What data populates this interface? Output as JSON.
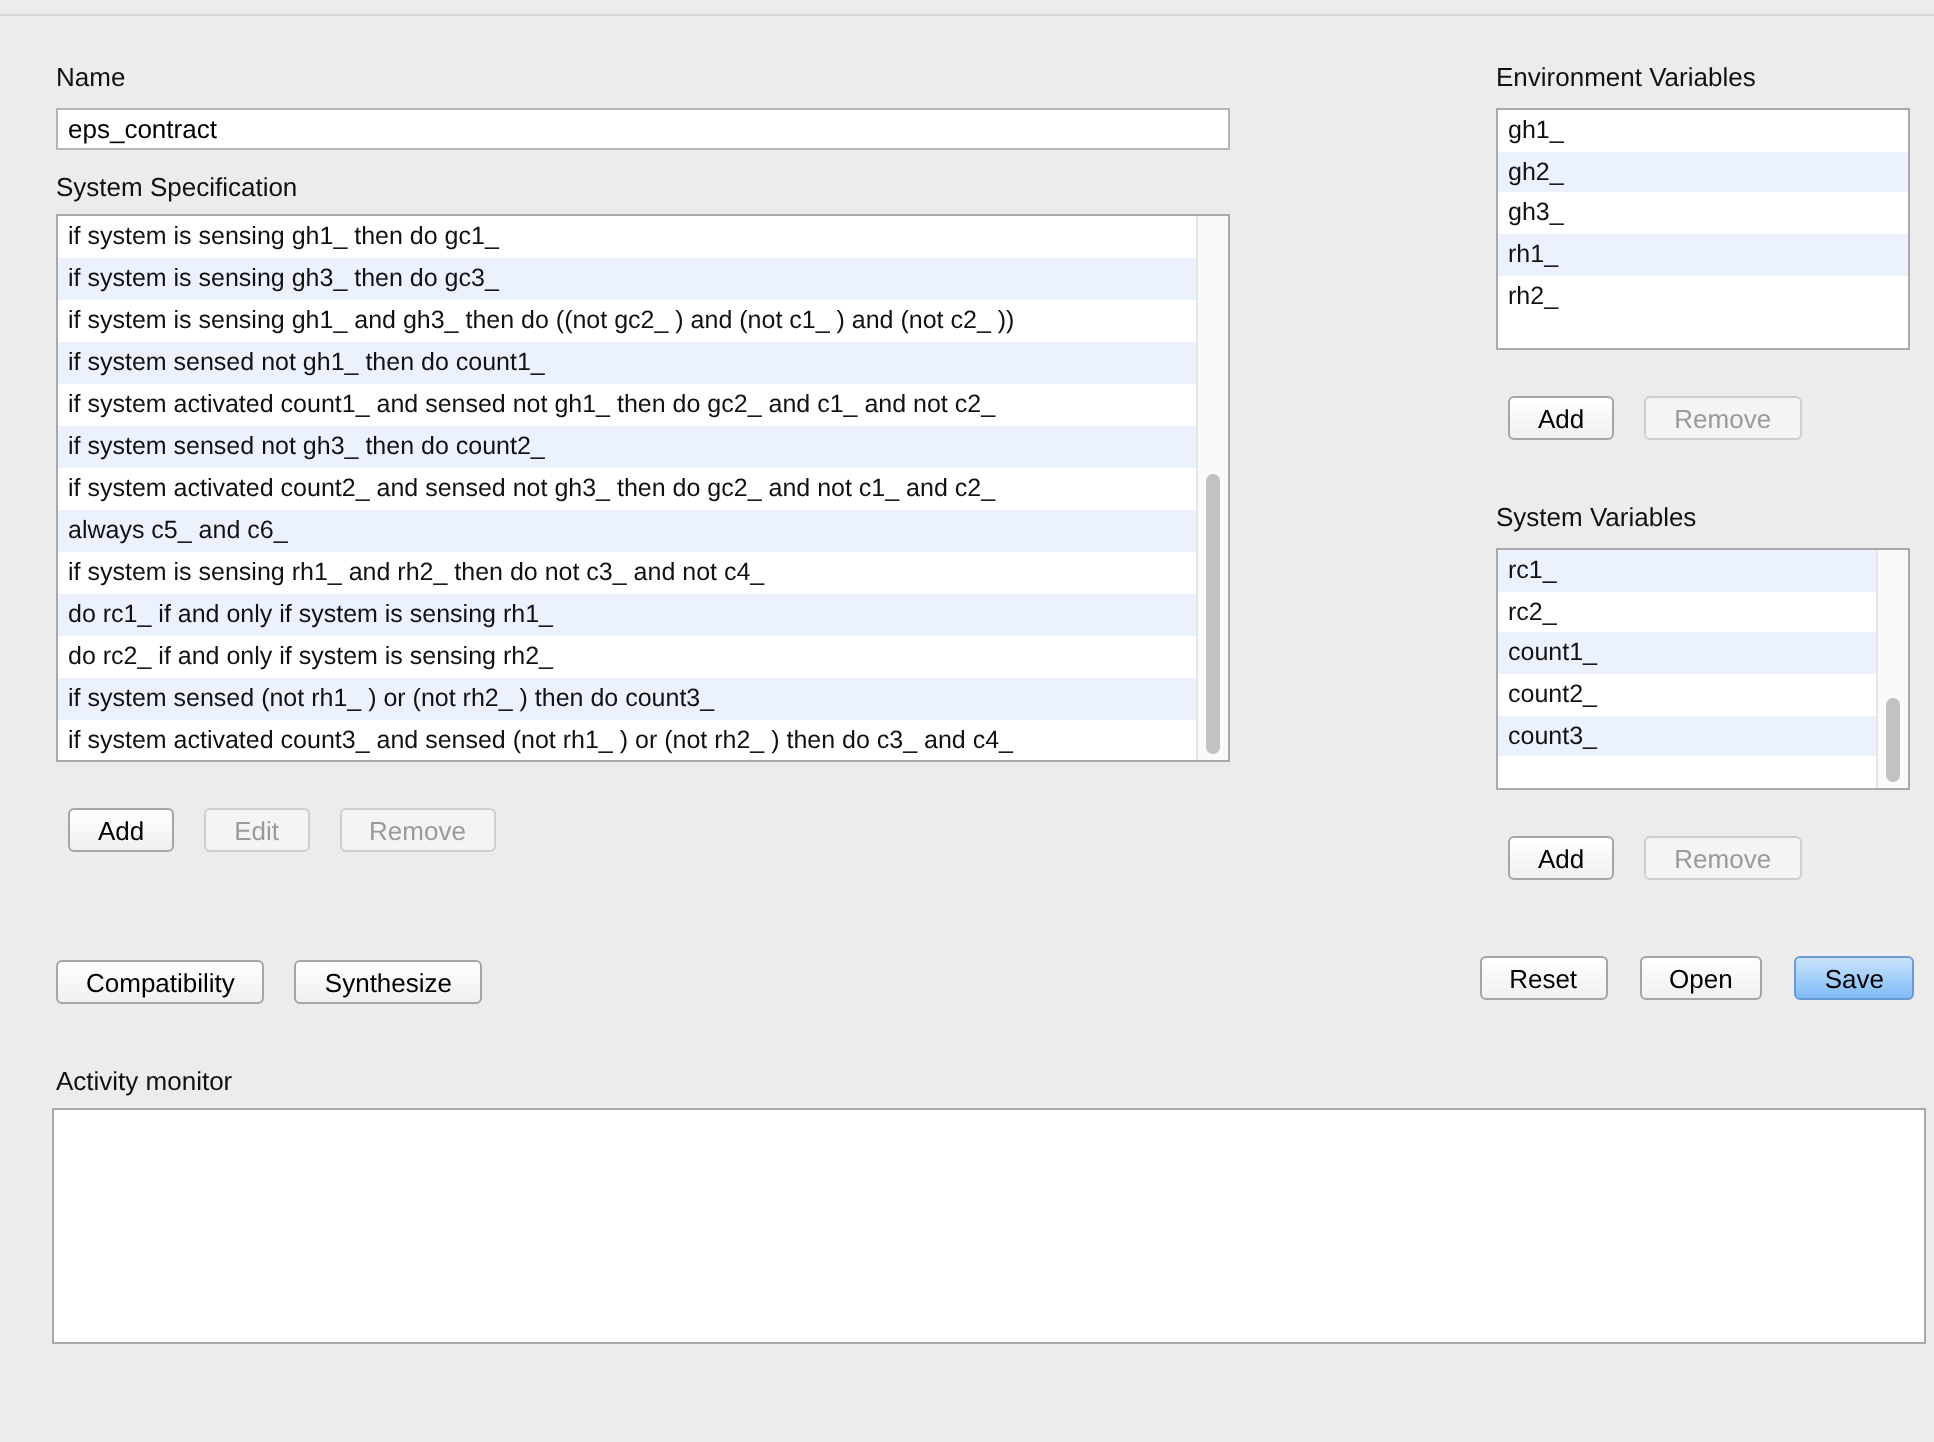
{
  "name": {
    "label": "Name",
    "value": "eps_contract"
  },
  "system_specification": {
    "label": "System Specification",
    "rows": [
      "if system is sensing gh1_ then do gc1_",
      "if system is sensing gh3_ then do gc3_",
      "if system is sensing gh1_ and gh3_ then do ((not gc2_ ) and (not c1_ ) and (not c2_ ))",
      "if system sensed not gh1_ then do count1_",
      "if system activated count1_ and sensed not gh1_ then do gc2_ and c1_ and not c2_",
      "if system sensed not gh3_ then do count2_",
      "if system activated count2_ and sensed not gh3_ then do gc2_ and not c1_ and c2_",
      "always c5_ and c6_",
      "if system is sensing rh1_ and rh2_ then do not c3_ and not c4_",
      "do rc1_ if and only if system is sensing rh1_",
      "do rc2_ if and only if system is sensing rh2_",
      "if system sensed (not rh1_ ) or (not rh2_ ) then do count3_",
      "if system activated count3_ and sensed (not rh1_ ) or (not rh2_ ) then do c3_ and c4_"
    ],
    "buttons": [
      {
        "label": "Add",
        "disabled": false
      },
      {
        "label": "Edit",
        "disabled": true
      },
      {
        "label": "Remove",
        "disabled": true
      }
    ]
  },
  "environment_variables": {
    "label": "Environment Variables",
    "rows": [
      "gh1_",
      "gh2_",
      "gh3_",
      "rh1_",
      "rh2_"
    ],
    "buttons": [
      {
        "label": "Add",
        "disabled": false
      },
      {
        "label": "Remove",
        "disabled": true
      }
    ]
  },
  "system_variables": {
    "label": "System Variables",
    "rows": [
      "rc1_",
      "rc2_",
      "count1_",
      "count2_",
      "count3_"
    ],
    "buttons": [
      {
        "label": "Add",
        "disabled": false
      },
      {
        "label": "Remove",
        "disabled": true
      }
    ]
  },
  "action_buttons": [
    {
      "label": "Compatibility",
      "default": false
    },
    {
      "label": "Synthesize",
      "default": false
    }
  ],
  "file_buttons": [
    {
      "label": "Reset",
      "default": false
    },
    {
      "label": "Open",
      "default": false
    },
    {
      "label": "Save",
      "default": true
    }
  ],
  "activity_monitor": {
    "label": "Activity monitor"
  }
}
